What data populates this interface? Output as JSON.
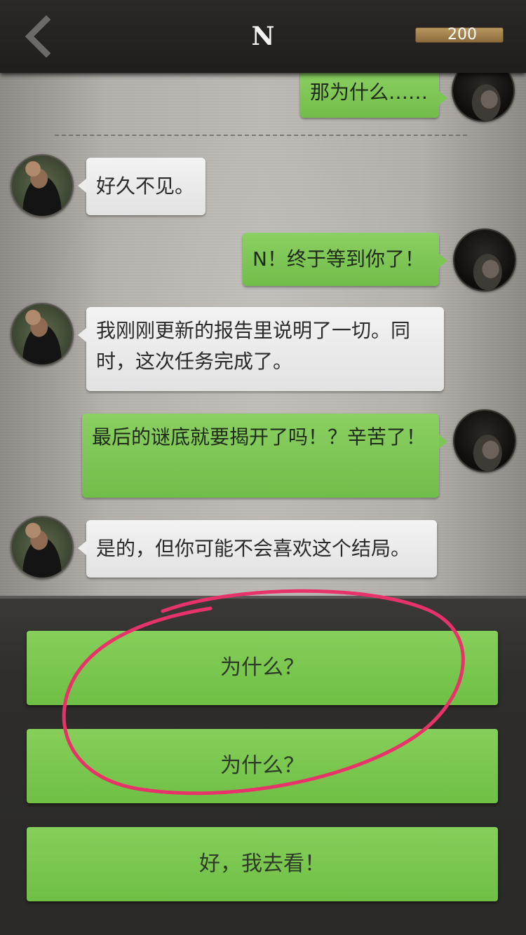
{
  "header": {
    "title": "N",
    "coins": "200"
  },
  "messages": [
    {
      "side": "right",
      "text": "那为什么……"
    },
    {
      "side": "left",
      "text": "好久不见。"
    },
    {
      "side": "right",
      "text": "N！终于等到你了！"
    },
    {
      "side": "left",
      "text": "我刚刚更新的报告里说明了一切。同时，这次任务完成了。"
    },
    {
      "side": "right",
      "text": "最后的谜底就要揭开了吗！？辛苦了！"
    },
    {
      "side": "left",
      "text": "是的，但你可能不会喜欢这个结局。"
    }
  ],
  "choices": [
    {
      "label": "为什么？"
    },
    {
      "label": "为什么？"
    },
    {
      "label": "好，我去看！"
    }
  ],
  "colors": {
    "accent_green": "#7cc653",
    "highlight_ring": "#e8336a",
    "coin_badge": "#a88550"
  },
  "icons": {
    "back": "chevron-left-icon"
  }
}
